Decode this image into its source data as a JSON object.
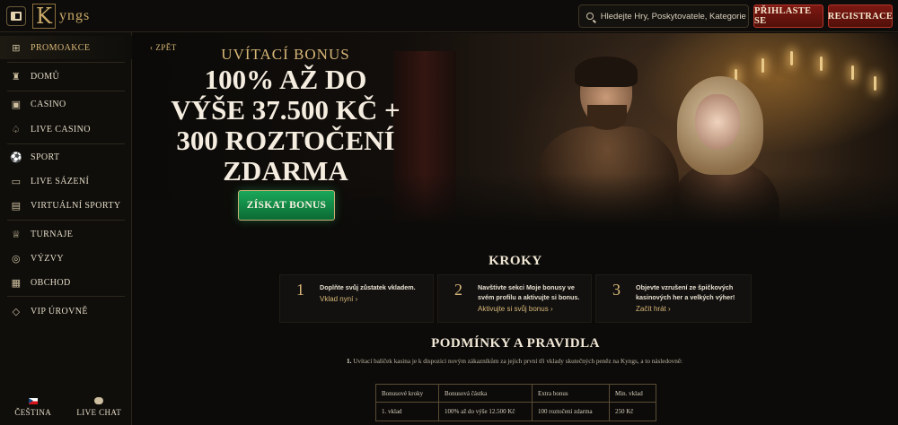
{
  "header": {
    "logo_text": "KYNGS",
    "search_placeholder": "Hledejte Hry, Poskytovatele, Kategorie",
    "login_label": "PŘIHLASTE SE",
    "register_label": "REGISTRACE"
  },
  "sidebar": {
    "items": [
      {
        "label": "PROMOAKCE",
        "icon": "gift-icon"
      },
      {
        "label": "DOMŮ",
        "icon": "castle-icon"
      },
      {
        "label": "CASINO",
        "icon": "slot-machine-icon"
      },
      {
        "label": "LIVE CASINO",
        "icon": "cards-icon"
      },
      {
        "label": "SPORT",
        "icon": "football-icon"
      },
      {
        "label": "LIVE SÁZENÍ",
        "icon": "live-icon"
      },
      {
        "label": "VIRTUÁLNÍ SPORTY",
        "icon": "virtual-sports-icon"
      },
      {
        "label": "TURNAJE",
        "icon": "trophy-icon"
      },
      {
        "label": "VÝZVY",
        "icon": "coins-icon"
      },
      {
        "label": "OBCHOD",
        "icon": "shop-icon"
      },
      {
        "label": "VIP ÚROVNĚ",
        "icon": "diamond-icon"
      }
    ],
    "language_label": "ČEŠTINA",
    "chat_label": "LIVE CHAT"
  },
  "hero": {
    "back_label": "ZPĚT",
    "subtitle": "UVÍTACÍ BONUS",
    "title_line1": "100% AŽ DO",
    "title_line2": "VÝŠE 37.500 KČ +",
    "title_line3": "300 ROZTOČENÍ",
    "title_line4": "ZDARMA",
    "cta_label": "ZÍSKAT BONUS"
  },
  "steps": {
    "title": "KROKY",
    "items": [
      {
        "num": "1",
        "text": "Doplňte svůj zůstatek vkladem.",
        "link": "Vklad nyní"
      },
      {
        "num": "2",
        "text": "Navštivte sekci Moje bonusy ve svém profilu a aktivujte si bonus.",
        "link": "Aktivujte si svůj bonus"
      },
      {
        "num": "3",
        "text": "Objevte vzrušení ze špičkových kasinových her a velkých výher!",
        "link": "Začít hrát"
      }
    ]
  },
  "rules": {
    "title": "PODMÍNKY A PRAVIDLA",
    "num": "1.",
    "text": "Uvítací balíček kasina je k dispozici novým zákazníkům za jejich první tři vklady skutečných peněz na Kyngs, a to následovně:",
    "table": {
      "headers": [
        "Bonusové kroky",
        "Bonusová částka",
        "Extra bonus",
        "Min. vklad"
      ],
      "rows": [
        [
          "1. vklad",
          "100% až do výše 12.500 Kč",
          "100 roztočení zdarma",
          "250 Kč"
        ]
      ]
    }
  }
}
